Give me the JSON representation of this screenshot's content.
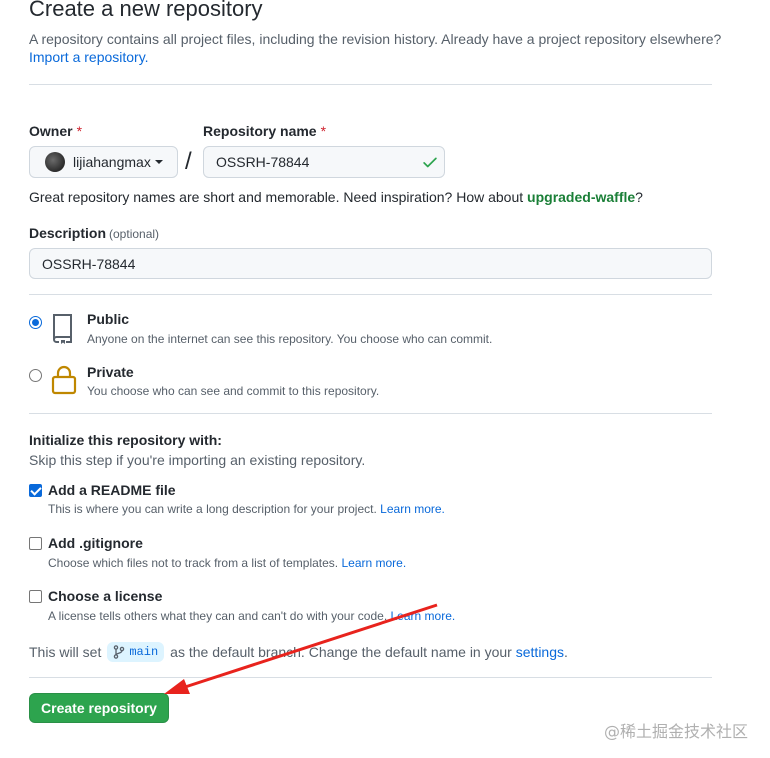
{
  "header": {
    "title": "Create a new repository",
    "subtitle": "A repository contains all project files, including the revision history. Already have a project repository elsewhere?",
    "import_link": "Import a repository."
  },
  "owner": {
    "label": "Owner",
    "required_mark": "*",
    "value": "lijiahangmax"
  },
  "separator": "/",
  "repository_name": {
    "label": "Repository name",
    "required_mark": "*",
    "value": "OSSRH-78844",
    "valid": true
  },
  "name_hint": {
    "text": "Great repository names are short and memorable. Need inspiration? How about ",
    "suggestion": "upgraded-waffle",
    "suffix": "?"
  },
  "description": {
    "label": "Description",
    "optional": "(optional)",
    "value": "OSSRH-78844"
  },
  "visibility": {
    "selected": "public",
    "options": [
      {
        "key": "public",
        "title": "Public",
        "desc": "Anyone on the internet can see this repository. You choose who can commit.",
        "icon": "repo-icon"
      },
      {
        "key": "private",
        "title": "Private",
        "desc": "You choose who can see and commit to this repository.",
        "icon": "lock-icon"
      }
    ]
  },
  "initialize": {
    "title": "Initialize this repository with:",
    "subtitle": "Skip this step if you're importing an existing repository.",
    "readme": {
      "title": "Add a README file",
      "desc": "This is where you can write a long description for your project.",
      "link": "Learn more.",
      "checked": true
    },
    "gitignore": {
      "title": "Add .gitignore",
      "desc": "Choose which files not to track from a list of templates.",
      "link": "Learn more.",
      "checked": false
    },
    "license": {
      "title": "Choose a license",
      "desc": "A license tells others what they can and can't do with your code.",
      "link": "Learn more.",
      "checked": false
    }
  },
  "branch": {
    "prefix": "This will set",
    "name": "main",
    "middle": "as the default branch. Change the default name in your",
    "settings_link": "settings",
    "suffix": "."
  },
  "submit": {
    "label": "Create repository"
  },
  "watermark": "@稀土掘金技术社区",
  "colors": {
    "accent": "#0969da",
    "success": "#2da44e",
    "suggestion": "#1a7f37",
    "required": "#cf222e",
    "annotation_arrow": "#e8231d"
  }
}
